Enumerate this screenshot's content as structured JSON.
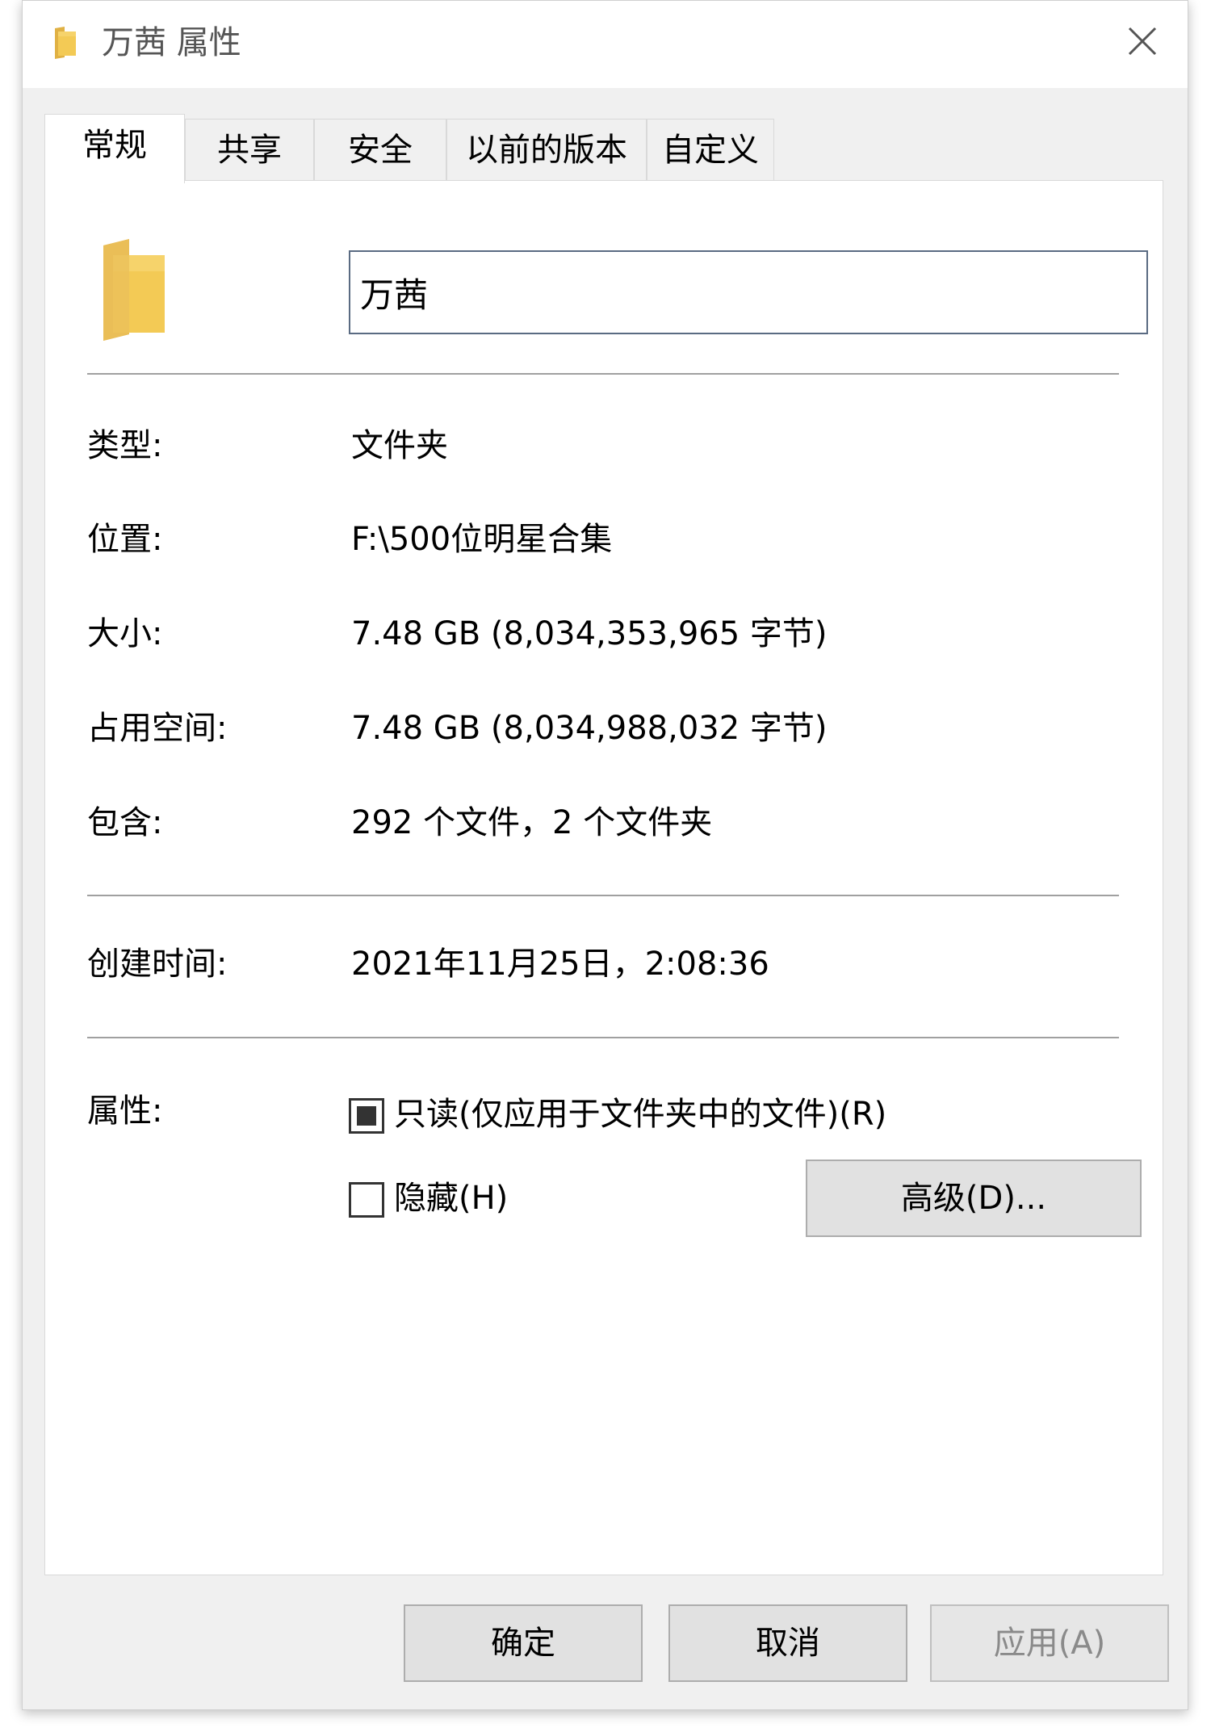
{
  "window": {
    "title": "万茜 属性"
  },
  "tabs": [
    {
      "label": "常规",
      "active": true
    },
    {
      "label": "共享",
      "active": false
    },
    {
      "label": "安全",
      "active": false
    },
    {
      "label": "以前的版本",
      "active": false
    },
    {
      "label": "自定义",
      "active": false
    }
  ],
  "name_field": {
    "value": "万茜"
  },
  "info": {
    "type_label": "类型:",
    "type_value": "文件夹",
    "location_label": "位置:",
    "location_value": "F:\\500位明星合集",
    "size_label": "大小:",
    "size_value": "7.48 GB (8,034,353,965 字节)",
    "disk_size_label": "占用空间:",
    "disk_size_value": "7.48 GB (8,034,988,032 字节)",
    "contains_label": "包含:",
    "contains_value": "292 个文件，2 个文件夹",
    "created_label": "创建时间:",
    "created_value": "2021年11月25日，2:08:36"
  },
  "attributes": {
    "label": "属性:",
    "readonly_label": "只读(仅应用于文件夹中的文件)(R)",
    "readonly_state": "indeterminate",
    "hidden_label": "隐藏(H)",
    "hidden_state": "unchecked",
    "advanced_label": "高级(D)..."
  },
  "buttons": {
    "ok": "确定",
    "cancel": "取消",
    "apply": "应用(A)"
  },
  "icons": {
    "folder": "folder-icon",
    "close": "close-icon"
  },
  "colors": {
    "folder_yellow": "#F6D36B",
    "folder_dark": "#E0B144",
    "input_border": "#5A6B82"
  }
}
